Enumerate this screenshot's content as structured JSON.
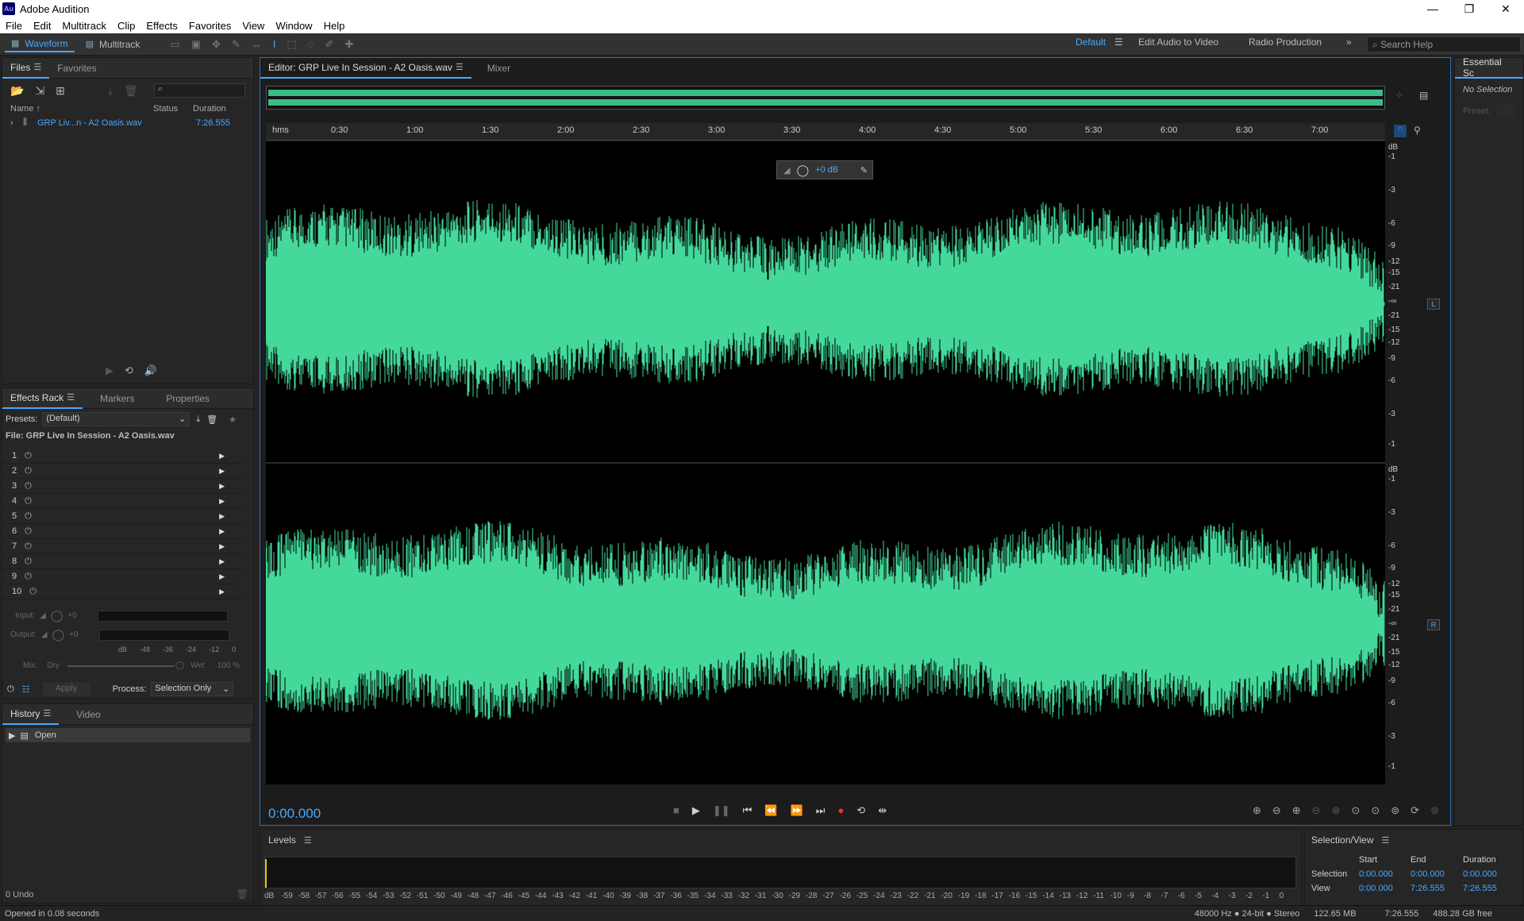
{
  "app": {
    "title": "Adobe Audition",
    "logo": "Au"
  },
  "menu": [
    "File",
    "Edit",
    "Multitrack",
    "Clip",
    "Effects",
    "Favorites",
    "View",
    "Window",
    "Help"
  ],
  "toolbar": {
    "waveform": "Waveform",
    "multitrack": "Multitrack",
    "workspaces": [
      "Default",
      "Edit Audio to Video",
      "Radio Production"
    ],
    "search_placeholder": "Search Help"
  },
  "files": {
    "tab_files": "Files",
    "tab_favorites": "Favorites",
    "col_name": "Name ↑",
    "col_status": "Status",
    "col_duration": "Duration",
    "file_name": "GRP Liv...n - A2 Oasis.wav",
    "file_duration": "7:26.555"
  },
  "rack": {
    "tab_effects": "Effects Rack",
    "tab_markers": "Markers",
    "tab_properties": "Properties",
    "presets_label": "Presets:",
    "preset_value": "(Default)",
    "file_label": "File: GRP Live In Session - A2 Oasis.wav",
    "slots": [
      "1",
      "2",
      "3",
      "4",
      "5",
      "6",
      "7",
      "8",
      "9",
      "10"
    ],
    "input_label": "Input:",
    "output_label": "Output:",
    "gain_input": "+0",
    "gain_output": "+0",
    "meter_scale": [
      "dB",
      "-48",
      "-36",
      "-24",
      "-12",
      "0"
    ],
    "mix_label": "Mix:",
    "dry": "Dry",
    "wet": "Wet",
    "wet_pct": "100 %",
    "apply": "Apply",
    "process_label": "Process:",
    "process_value": "Selection Only"
  },
  "history": {
    "tab_history": "History",
    "tab_video": "Video",
    "item": "Open",
    "undo": "0 Undo"
  },
  "editor": {
    "tab_title": "Editor: GRP Live In Session - A2 Oasis.wav",
    "tab_mixer": "Mixer",
    "ruler_unit": "hms",
    "ruler_ticks": [
      "0:30",
      "1:00",
      "1:30",
      "2:00",
      "2:30",
      "3:00",
      "3:30",
      "4:00",
      "4:30",
      "5:00",
      "5:30",
      "6:00",
      "6:30",
      "7:00"
    ],
    "hud_gain": "+0 dB",
    "db_ticks": [
      "dB",
      "-1",
      "-3",
      "-6",
      "-9",
      "-12",
      "-15",
      "-21",
      "-∞",
      "-21",
      "-15",
      "-12",
      "-9",
      "-6",
      "-3",
      "-1"
    ],
    "chan_l": "L",
    "chan_r": "R",
    "timecode": "0:00.000",
    "wave_color": "#44d99a"
  },
  "levels": {
    "title": "Levels",
    "scale": [
      "dB",
      "-59",
      "-58",
      "-57",
      "-56",
      "-55",
      "-54",
      "-53",
      "-52",
      "-51",
      "-50",
      "-49",
      "-48",
      "-47",
      "-46",
      "-45",
      "-44",
      "-43",
      "-42",
      "-41",
      "-40",
      "-39",
      "-38",
      "-37",
      "-36",
      "-35",
      "-34",
      "-33",
      "-32",
      "-31",
      "-30",
      "-29",
      "-28",
      "-27",
      "-26",
      "-25",
      "-24",
      "-23",
      "-22",
      "-21",
      "-20",
      "-19",
      "-18",
      "-17",
      "-16",
      "-15",
      "-14",
      "-13",
      "-12",
      "-11",
      "-10",
      "-9",
      "-8",
      "-7",
      "-6",
      "-5",
      "-4",
      "-3",
      "-2",
      "-1",
      "0"
    ]
  },
  "selview": {
    "title": "Selection/View",
    "h_start": "Start",
    "h_end": "End",
    "h_duration": "Duration",
    "sel_label": "Selection",
    "sel_start": "0:00.000",
    "sel_end": "0:00.000",
    "sel_dur": "0:00.000",
    "view_label": "View",
    "view_start": "0:00.000",
    "view_end": "7:26.555",
    "view_dur": "7:26.555"
  },
  "essential": {
    "title": "Essential Sc",
    "no_selection": "No Selection",
    "preset": "Preset:"
  },
  "status": {
    "left": "Opened in 0.08 seconds",
    "format": "48000 Hz ● 24-bit ● Stereo",
    "size": "122.65 MB",
    "duration": "7:26.555",
    "free": "488.28 GB free"
  }
}
